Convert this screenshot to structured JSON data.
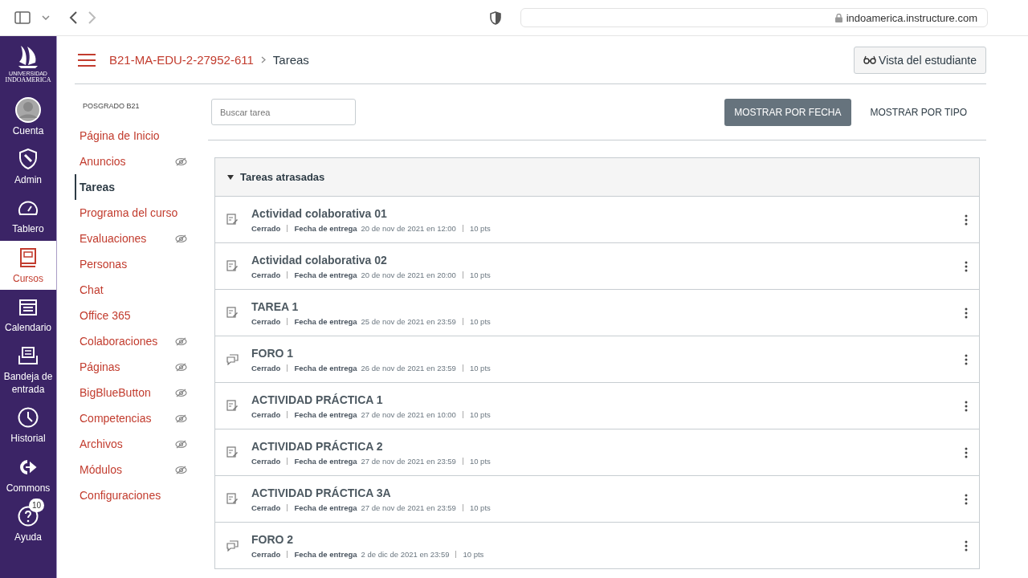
{
  "browser": {
    "url": "indoamerica.instructure.com"
  },
  "logo": {
    "line_1": "UNIVERSIDAD",
    "line_2": "INDOAMERICA"
  },
  "global_nav": [
    {
      "kind": "account",
      "label": "Cuenta",
      "selected": false
    },
    {
      "kind": "admin",
      "label": "Admin",
      "selected": false
    },
    {
      "kind": "dashboard",
      "label": "Tablero",
      "selected": false
    },
    {
      "kind": "courses",
      "label": "Cursos",
      "selected": true
    },
    {
      "kind": "calendar",
      "label": "Calendario",
      "selected": false
    },
    {
      "kind": "inbox",
      "label": "Bandeja de entrada",
      "selected": false
    },
    {
      "kind": "history",
      "label": "Historial",
      "selected": false
    },
    {
      "kind": "commons",
      "label": "Commons",
      "selected": false
    },
    {
      "kind": "help",
      "label": "Ayuda",
      "selected": false,
      "badge": "10"
    }
  ],
  "breadcrumb": {
    "course": "B21-MA-EDU-2-27952-611",
    "page": "Tareas"
  },
  "student_view_button": "Vista del estudiante",
  "course_nav": {
    "term": "POSGRADO B21",
    "items": [
      {
        "label": "Página de Inicio",
        "selected": false,
        "hidden": false
      },
      {
        "label": "Anuncios",
        "selected": false,
        "hidden": true
      },
      {
        "label": "Tareas",
        "selected": true,
        "hidden": false
      },
      {
        "label": "Programa del curso",
        "selected": false,
        "hidden": false
      },
      {
        "label": "Evaluaciones",
        "selected": false,
        "hidden": true
      },
      {
        "label": "Personas",
        "selected": false,
        "hidden": false
      },
      {
        "label": "Chat",
        "selected": false,
        "hidden": false
      },
      {
        "label": "Office 365",
        "selected": false,
        "hidden": false
      },
      {
        "label": "Colaboraciones",
        "selected": false,
        "hidden": true
      },
      {
        "label": "Páginas",
        "selected": false,
        "hidden": true
      },
      {
        "label": "BigBlueButton",
        "selected": false,
        "hidden": true
      },
      {
        "label": "Competencias",
        "selected": false,
        "hidden": true
      },
      {
        "label": "Archivos",
        "selected": false,
        "hidden": true
      },
      {
        "label": "Módulos",
        "selected": false,
        "hidden": true
      },
      {
        "label": "Configuraciones",
        "selected": false,
        "hidden": false
      }
    ]
  },
  "search": {
    "placeholder": "Buscar tarea"
  },
  "sort_buttons": [
    {
      "label": "MOSTRAR POR FECHA",
      "selected": true
    },
    {
      "label": "MOSTRAR POR TIPO",
      "selected": false
    }
  ],
  "group": {
    "title": "Tareas atrasadas",
    "expanded": true,
    "assignments": [
      {
        "kind": "assignment",
        "title": "Actividad colaborativa 01",
        "status": "Cerrado",
        "due_label": "Fecha de entrega",
        "due": "20 de nov de 2021 en 12:00",
        "points": "10 pts"
      },
      {
        "kind": "assignment",
        "title": "Actividad colaborativa 02",
        "status": "Cerrado",
        "due_label": "Fecha de entrega",
        "due": "20 de nov de 2021 en 20:00",
        "points": "10 pts"
      },
      {
        "kind": "assignment",
        "title": "TAREA 1",
        "status": "Cerrado",
        "due_label": "Fecha de entrega",
        "due": "25 de nov de 2021 en 23:59",
        "points": "10 pts"
      },
      {
        "kind": "discussion",
        "title": "FORO 1",
        "status": "Cerrado",
        "due_label": "Fecha de entrega",
        "due": "26 de nov de 2021 en 23:59",
        "points": "10 pts"
      },
      {
        "kind": "assignment",
        "title": "ACTIVIDAD PRÁCTICA 1",
        "status": "Cerrado",
        "due_label": "Fecha de entrega",
        "due": "27 de nov de 2021 en 10:00",
        "points": "10 pts"
      },
      {
        "kind": "assignment",
        "title": "ACTIVIDAD PRÁCTICA 2",
        "status": "Cerrado",
        "due_label": "Fecha de entrega",
        "due": "27 de nov de 2021 en 23:59",
        "points": "10 pts"
      },
      {
        "kind": "assignment",
        "title": "ACTIVIDAD PRÁCTICA 3A",
        "status": "Cerrado",
        "due_label": "Fecha de entrega",
        "due": "27 de nov de 2021 en 23:59",
        "points": "10 pts"
      },
      {
        "kind": "discussion",
        "title": "FORO 2",
        "status": "Cerrado",
        "due_label": "Fecha de entrega",
        "due": "2 de dic de 2021 en 23:59",
        "points": "10 pts"
      }
    ]
  }
}
